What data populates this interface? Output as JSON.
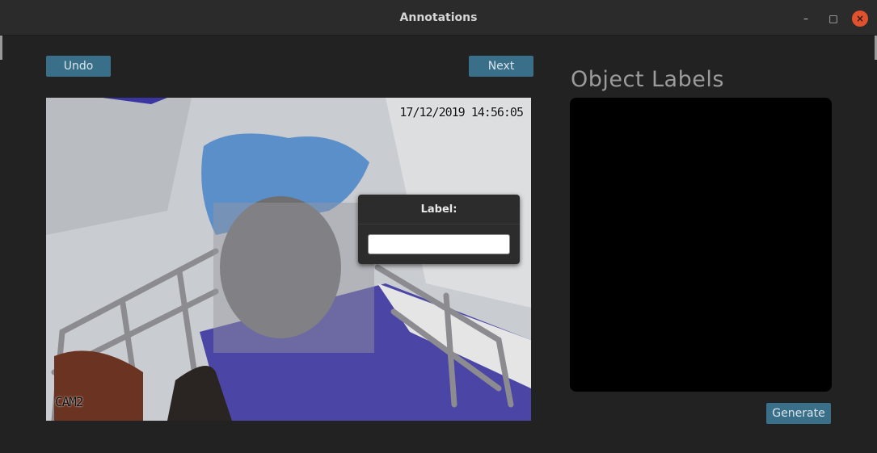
{
  "window": {
    "title": "Annotations",
    "controls": {
      "minimize": "–",
      "maximize": "□",
      "close": "×"
    }
  },
  "toolbar": {
    "undo_label": "Undo",
    "next_label": "Next"
  },
  "image": {
    "timestamp": "17/12/2019 14:56:05",
    "camera_name": "CAM2"
  },
  "label_dialog": {
    "title": "Label:",
    "input_value": "",
    "input_placeholder": ""
  },
  "object_labels": {
    "heading": "Object Labels",
    "items": []
  },
  "generate_label": "Generate",
  "colors": {
    "window_bg": "#222222",
    "accent_button": "#3a6f8a",
    "close_button": "#e0522e",
    "labels_panel": "#000000"
  }
}
